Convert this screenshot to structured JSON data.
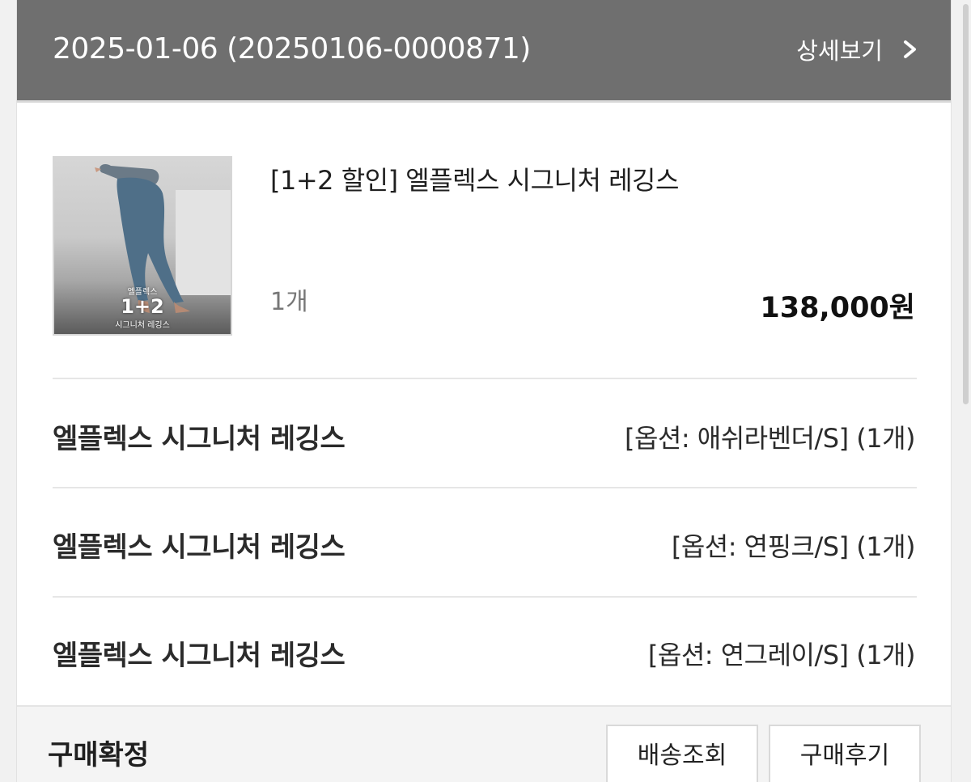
{
  "order": {
    "date": "2025-01-06",
    "number": "(20250106-0000871)",
    "detail_label": "상세보기"
  },
  "product": {
    "thumb_text_top": "엘플렉스",
    "thumb_text_mid": "1+2",
    "thumb_text_bottom": "시그니처 레깅스",
    "name": "[1+2 할인] 엘플렉스 시그니처 레깅스",
    "quantity": "1개",
    "price": "138,000원"
  },
  "options": [
    {
      "name": "엘플렉스 시그니처 레깅스",
      "value": "[옵션: 애쉬라벤더/S] (1개)"
    },
    {
      "name": "엘플렉스 시그니처 레깅스",
      "value": "[옵션: 연핑크/S] (1개)"
    },
    {
      "name": "엘플렉스 시그니처 레깅스",
      "value": "[옵션: 연그레이/S] (1개)"
    }
  ],
  "footer": {
    "status": "구매확정",
    "track_button": "배송조회",
    "review_button": "구매후기"
  },
  "colors": {
    "header_bg": "#6f6f6f",
    "text_dark": "#2b2b2b",
    "text_muted": "#777777",
    "footer_bg": "#f4f4f4",
    "legging": "#4f6f88"
  },
  "icons": {
    "detail": "chevron-right-icon"
  }
}
